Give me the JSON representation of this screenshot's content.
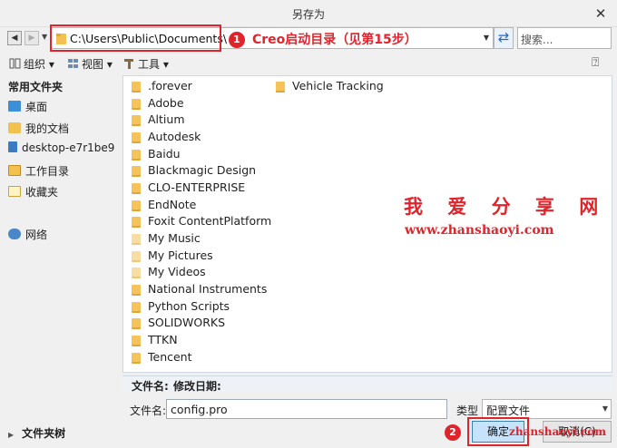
{
  "window": {
    "title": "另存为"
  },
  "nav": {
    "path": "C:\\Users\\Public\\Documents\\",
    "search_placeholder": "搜索..."
  },
  "annotations": {
    "badge1": "1",
    "label1": "Creo启动目录（见第15步）",
    "badge2": "2",
    "watermark_title": "我 爱 分 享 网",
    "watermark_url": "www.zhanshaoyi.com",
    "watermark_url_small": "zhanshaoyi.com"
  },
  "toolbar": {
    "organize": "组织",
    "view": "视图",
    "tools": "工具"
  },
  "sidebar": {
    "heading": "常用文件夹",
    "items": [
      {
        "label": "桌面",
        "icon": "desktop-icon"
      },
      {
        "label": "我的文档",
        "icon": "documents-icon"
      },
      {
        "label": "desktop-e7r1be9",
        "icon": "computer-icon"
      },
      {
        "label": "工作目录",
        "icon": "working-dir-icon"
      },
      {
        "label": "收藏夹",
        "icon": "favorites-icon"
      },
      {
        "label": "网络",
        "icon": "network-icon"
      }
    ],
    "folder_tree": "文件夹树"
  },
  "files": {
    "col1": [
      ".forever",
      "Adobe",
      "Altium",
      "Autodesk",
      "Baidu",
      "Blackmagic Design",
      "CLO-ENTERPRISE",
      "EndNote",
      "Foxit ContentPlatform",
      "My Music",
      "My Pictures",
      "My Videos",
      "National Instruments",
      "Python Scripts",
      "SOLIDWORKS",
      "TTKN",
      "Tencent"
    ],
    "col2": [
      "Vehicle Tracking"
    ]
  },
  "details": {
    "filename_label": "文件名:",
    "modified_label": "修改日期:"
  },
  "form": {
    "filename_label": "文件名:",
    "filename_value": "config.pro",
    "type_label": "类型",
    "type_value": "配置文件"
  },
  "buttons": {
    "ok": "确定",
    "cancel": "取消(C)"
  }
}
